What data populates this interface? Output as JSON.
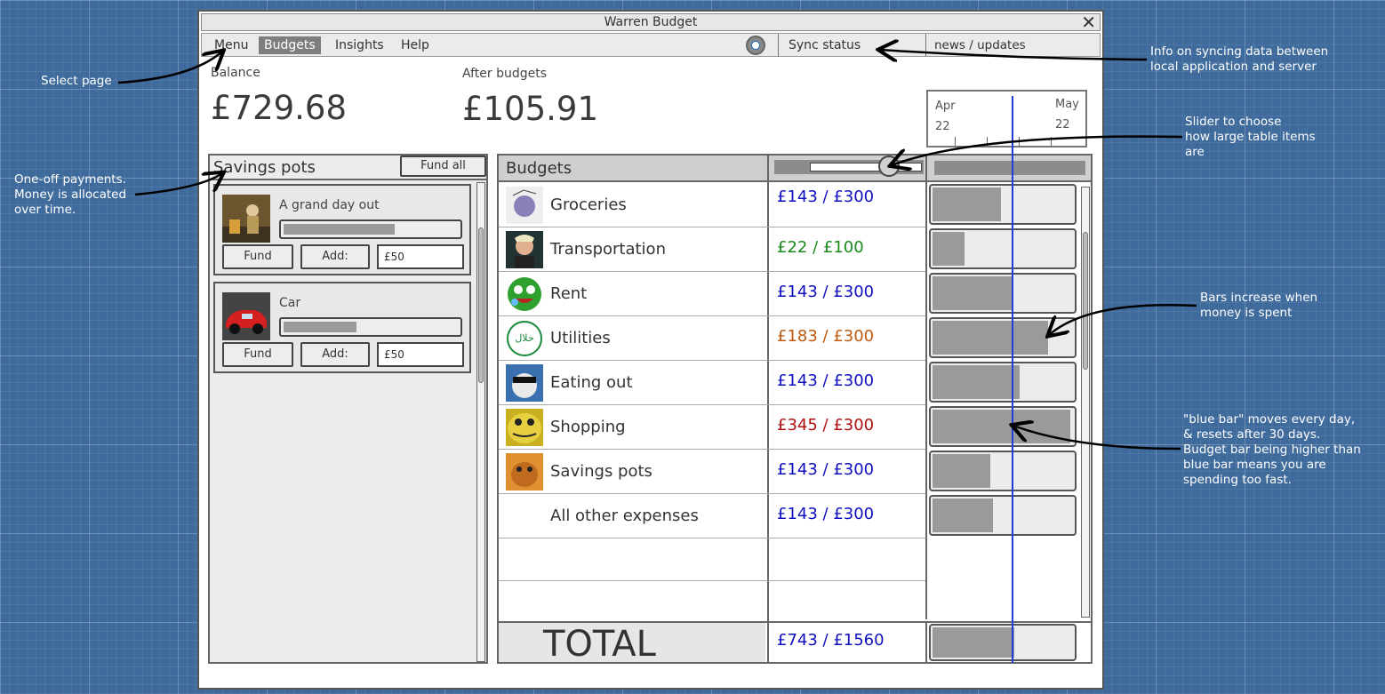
{
  "window": {
    "title": "Warren Budget",
    "close_glyph": "✕"
  },
  "menu": {
    "items": [
      {
        "label": "Menu",
        "active": false
      },
      {
        "label": "Budgets",
        "active": true
      },
      {
        "label": "Insights",
        "active": false
      },
      {
        "label": "Help",
        "active": false
      }
    ],
    "settings_icon": "gear-icon",
    "sync_status": "Sync status",
    "news": "news / updates"
  },
  "summary": {
    "balance_label": "Balance",
    "balance_value": "£729.68",
    "after_label": "After budgets",
    "after_value": "£105.91"
  },
  "timeline": {
    "start_month": "Apr",
    "start_day": "22",
    "end_month": "May",
    "end_day": "22"
  },
  "savings": {
    "title": "Savings pots",
    "fund_all": "Fund all",
    "pots": [
      {
        "name": "A grand day out",
        "progress": 0.64,
        "fund_label": "Fund",
        "add_label": "Add:",
        "add_value": "£50"
      },
      {
        "name": "Car",
        "progress": 0.42,
        "fund_label": "Fund",
        "add_label": "Add:",
        "add_value": "£50"
      }
    ]
  },
  "budgets": {
    "title": "Budgets",
    "size_slider_value": 0.72,
    "rows": [
      {
        "name": "Groceries",
        "amount": "£143 / £300",
        "color": "#1010c0",
        "spent": 0.49
      },
      {
        "name": "Transportation",
        "amount": "£22 / £100",
        "color": "#1a8a1a",
        "spent": 0.23
      },
      {
        "name": "Rent",
        "amount": "£143 / £300",
        "color": "#1010c0",
        "spent": 0.57
      },
      {
        "name": "Utilities",
        "amount": "£183 / £300",
        "color": "#c05a10",
        "spent": 0.82
      },
      {
        "name": "Eating out",
        "amount": "£143 / £300",
        "color": "#1010c0",
        "spent": 0.62
      },
      {
        "name": "Shopping",
        "amount": "£345 / £300",
        "color": "#b01010",
        "spent": 0.98
      },
      {
        "name": "Savings pots",
        "amount": "£143 / £300",
        "color": "#1010c0",
        "spent": 0.41
      },
      {
        "name": "All other expenses",
        "amount": "£143 / £300",
        "color": "#1010c0",
        "spent": 0.43
      }
    ],
    "total_label": "TOTAL",
    "total_amount": "£743 / £1560",
    "total_spent": 0.58
  },
  "annotations": {
    "select_page": "Select page",
    "sync_info": "Info on syncing data between\nlocal application and server",
    "slider_info": "Slider to choose\nhow large table items\nare",
    "one_off": "One-off payments.\nMoney is allocated\nover time.",
    "bars_info": "Bars increase when\nmoney is spent",
    "blue_bar_info": "\"blue bar\" moves every day,\n& resets after 30 days.\nBudget bar being higher than\nblue bar means you are\nspending too fast."
  },
  "colors": {
    "background": "#3e6a9c",
    "blue_bar": "#1f3fd6",
    "amount_blue": "#1010c0",
    "amount_green": "#1a8a1a",
    "amount_orange": "#c05a10",
    "amount_red": "#b01010"
  }
}
